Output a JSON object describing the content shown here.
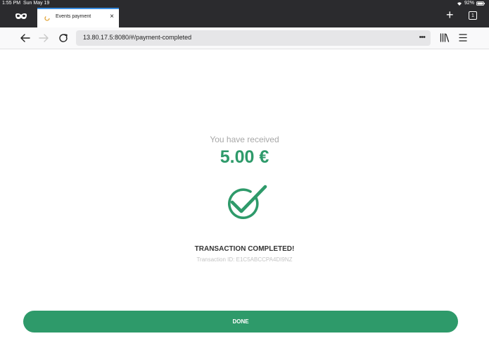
{
  "status_bar": {
    "time": "1:55 PM",
    "date": "Sun May 19",
    "battery": "92%"
  },
  "browser": {
    "tab": {
      "title": "Events payment",
      "close_symbol": "×"
    },
    "tab_count": "1",
    "new_tab_symbol": "+",
    "url": "13.80.17.5:8080/#/payment-completed",
    "page_actions_symbol": "•••"
  },
  "payment": {
    "received_label": "You have received",
    "amount": "5.00 €",
    "status_title": "TRANSACTION COMPLETED!",
    "transaction_id_label": "Transaction ID:",
    "transaction_id": "E1C5ABCCPA4DI9NZ",
    "done_label": "DONE"
  },
  "colors": {
    "accent": "#2e9a6a",
    "chrome_dark": "#2b2b2e",
    "tab_highlight": "#3a8de0"
  },
  "icons": {
    "private": "mask-icon",
    "back": "back-arrow-icon",
    "forward": "forward-arrow-icon",
    "reload": "reload-icon",
    "library": "library-icon",
    "menu": "hamburger-menu-icon",
    "check": "check-circle-icon"
  }
}
